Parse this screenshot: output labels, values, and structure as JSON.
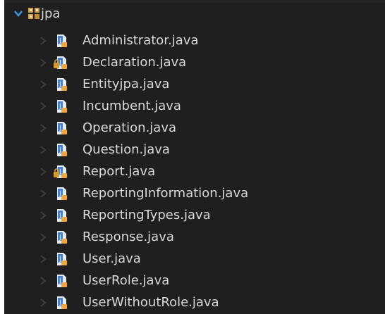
{
  "tree": {
    "package": {
      "name": "jpa",
      "icon": "java-package-icon",
      "expanded": true
    },
    "items": [
      {
        "label": "Administrator.java",
        "icon": "java-file-icon",
        "lock": false
      },
      {
        "label": "Declaration.java",
        "icon": "java-file-locked-icon",
        "lock": true
      },
      {
        "label": "Entityjpa.java",
        "icon": "java-file-icon",
        "lock": false
      },
      {
        "label": "Incumbent.java",
        "icon": "java-file-icon",
        "lock": false
      },
      {
        "label": "Operation.java",
        "icon": "java-file-icon",
        "lock": false
      },
      {
        "label": "Question.java",
        "icon": "java-file-icon",
        "lock": false
      },
      {
        "label": "Report.java",
        "icon": "java-file-locked-icon",
        "lock": true
      },
      {
        "label": "ReportingInformation.java",
        "icon": "java-file-icon",
        "lock": false
      },
      {
        "label": "ReportingTypes.java",
        "icon": "java-file-icon",
        "lock": false
      },
      {
        "label": "Response.java",
        "icon": "java-file-icon",
        "lock": false
      },
      {
        "label": "User.java",
        "icon": "java-file-icon",
        "lock": false
      },
      {
        "label": "UserRole.java",
        "icon": "java-file-icon",
        "lock": false
      },
      {
        "label": "UserWithoutRole.java",
        "icon": "java-file-icon",
        "lock": false
      }
    ]
  },
  "colors": {
    "background": "#1f1f1f",
    "text": "#d8d8d8",
    "accent": "#2f8dd8",
    "file_icon_blue": "#4a7fcf",
    "file_icon_orange": "#f0a83a",
    "twisty_expanded": "#3a9ae6",
    "twisty_collapsed": "#3c3c3c"
  }
}
